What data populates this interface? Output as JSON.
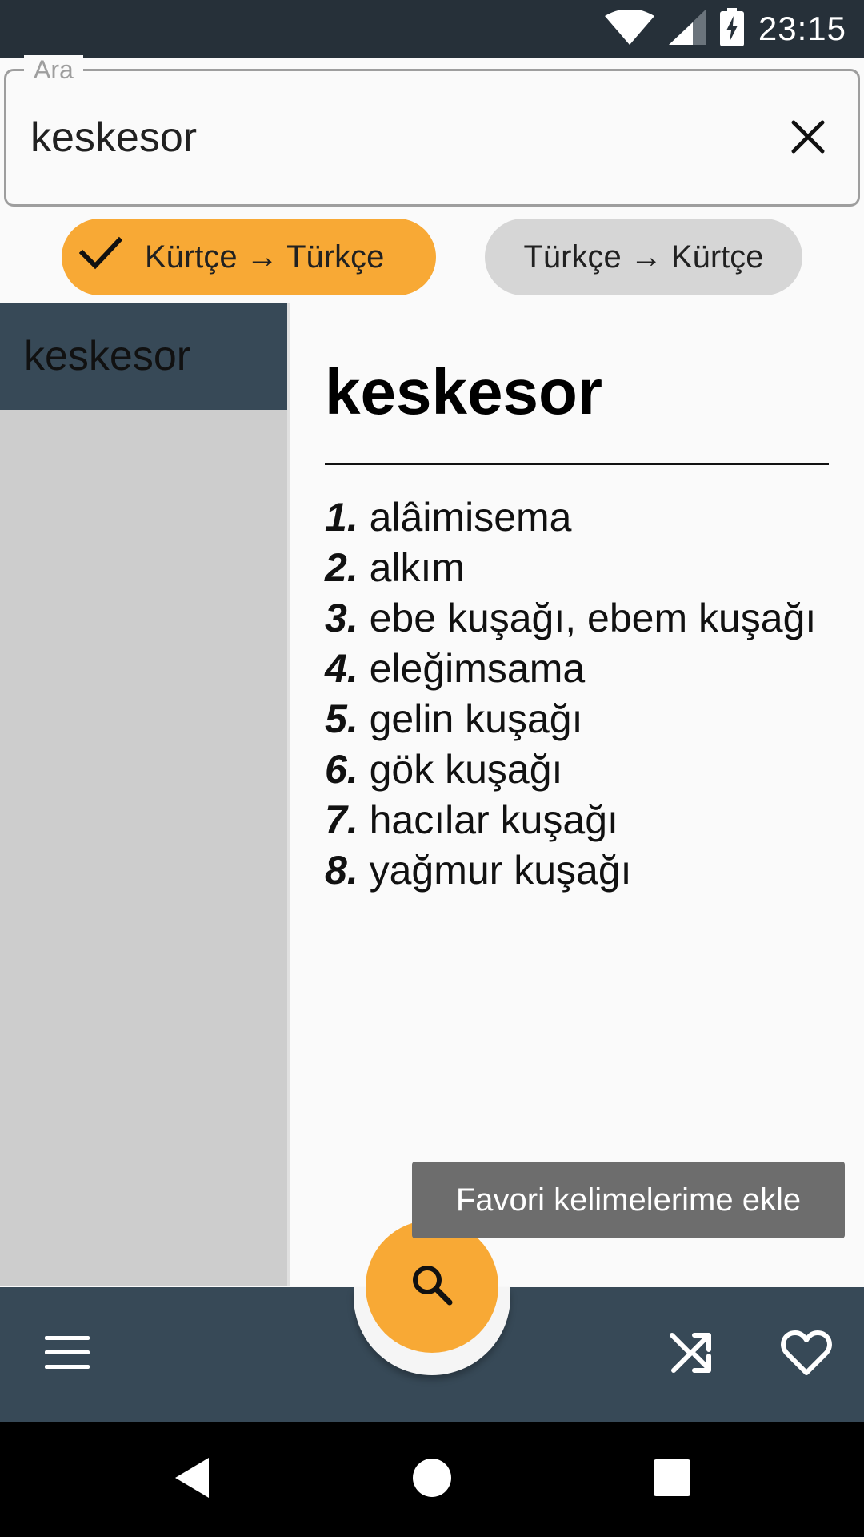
{
  "status_bar": {
    "time": "23:15",
    "icons": [
      "wifi-icon",
      "cell-signal-icon",
      "battery-charging-icon"
    ]
  },
  "search": {
    "legend": "Ara",
    "value": "keskesor",
    "clear_icon": "close-icon"
  },
  "direction_chips": {
    "active": {
      "label": "Kürtçe → Türkçe",
      "icon": "check-icon",
      "color": "#f8a935"
    },
    "inactive": {
      "label": "Türkçe → Kürtçe",
      "color": "#d6d6d6"
    }
  },
  "word_list": {
    "items": [
      {
        "label": "keskesor",
        "selected": true
      }
    ]
  },
  "definition": {
    "headword": "keskesor",
    "meanings": [
      {
        "num": "1.",
        "text": "alâimisema"
      },
      {
        "num": "2.",
        "text": "alkım"
      },
      {
        "num": "3.",
        "text": "ebe kuşağı, ebem kuşağı"
      },
      {
        "num": "4.",
        "text": "eleğimsama"
      },
      {
        "num": "5.",
        "text": "gelin kuşağı"
      },
      {
        "num": "6.",
        "text": "gök kuşağı"
      },
      {
        "num": "7.",
        "text": "hacılar kuşağı"
      },
      {
        "num": "8.",
        "text": "yağmur kuşağı"
      }
    ]
  },
  "tooltip": {
    "text": "Favori kelimelerime ekle"
  },
  "bottom_bar": {
    "color": "#374957",
    "accent": "#f8a935",
    "left_icon": "menu-icon",
    "fab_icon": "search-icon",
    "right_icons": [
      "shuffle-icon",
      "heart-outline-icon"
    ]
  },
  "nav_bar": {
    "icons": [
      "back-icon",
      "home-icon",
      "recents-icon"
    ]
  }
}
